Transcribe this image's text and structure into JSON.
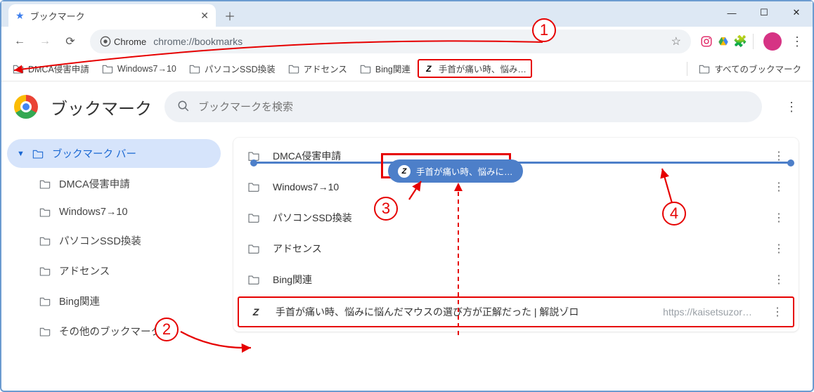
{
  "tab": {
    "title": "ブックマーク"
  },
  "address": "chrome://bookmarks",
  "address_label": "Chrome",
  "bookmarks_bar": [
    {
      "label": "DMCA侵害申請"
    },
    {
      "label": "Windows7→10"
    },
    {
      "label": "パソコンSSD換装"
    },
    {
      "label": "アドセンス"
    },
    {
      "label": "Bing関連"
    }
  ],
  "bookmarks_bar_link": {
    "label": "手首が痛い時、悩み…"
  },
  "all_bookmarks": "すべてのブックマーク",
  "page_title": "ブックマーク",
  "search_placeholder": "ブックマークを検索",
  "sidebar": {
    "root": "ブックマーク バー",
    "items": [
      "DMCA侵害申請",
      "Windows7→10",
      "パソコンSSD換装",
      "アドセンス",
      "Bing関連",
      "その他のブックマーク"
    ]
  },
  "list": [
    {
      "label": "DMCA侵害申請"
    },
    {
      "label": "Windows7→10"
    },
    {
      "label": "パソコンSSD換装"
    },
    {
      "label": "アドセンス"
    },
    {
      "label": "Bing関連"
    }
  ],
  "list_link": {
    "label": "手首が痛い時、悩みに悩んだマウスの選び方が正解だった | 解説ゾロ",
    "url": "https://kaisetsuzor…"
  },
  "drag_chip": "手首が痛い時、悩みに…",
  "annotations": {
    "n1": "1",
    "n2": "2",
    "n3": "3",
    "n4": "4"
  }
}
